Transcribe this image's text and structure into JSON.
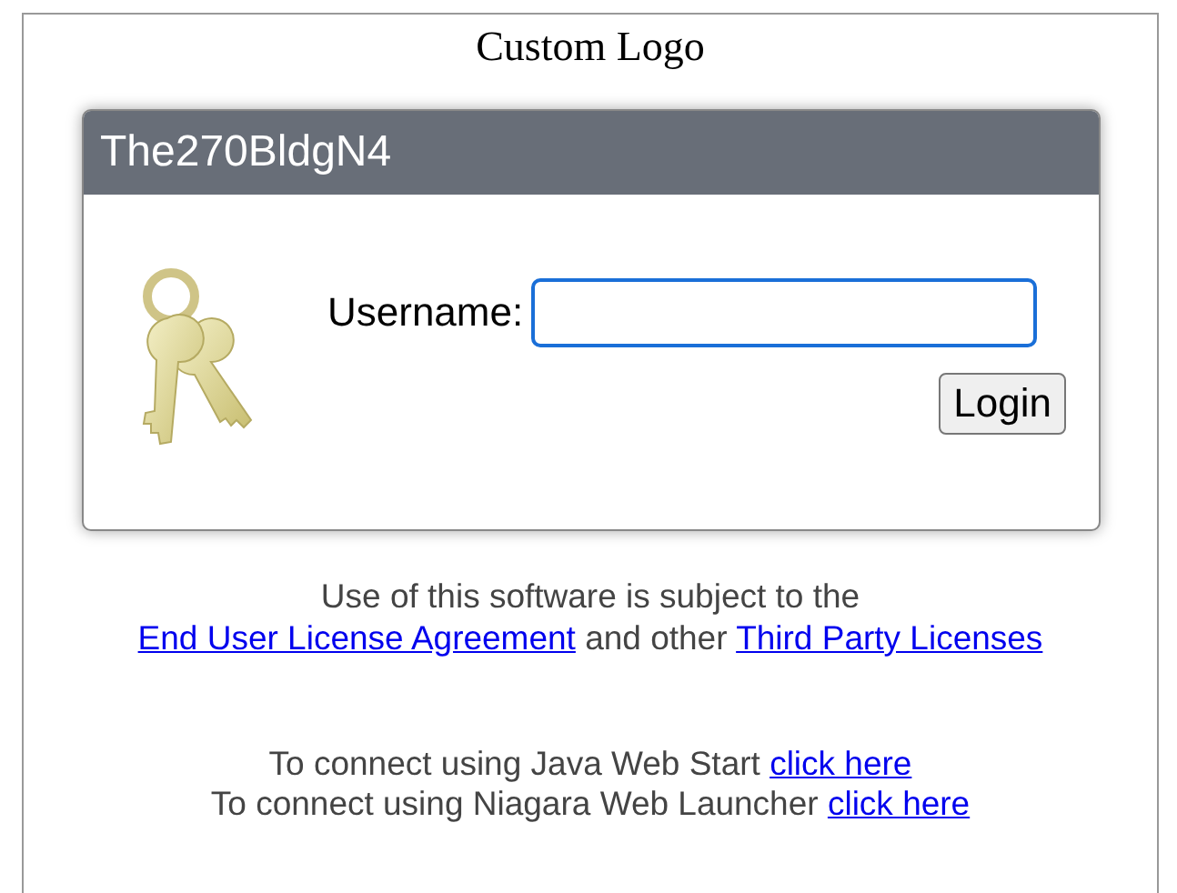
{
  "logo": "Custom Logo",
  "login": {
    "title": "The270BldgN4",
    "username_label": "Username:",
    "button": "Login"
  },
  "legal": {
    "before": "Use of this software is subject to the",
    "link1": "End User License Agreement",
    "middle": "and other",
    "link2": "Third Party Licenses"
  },
  "connect": [
    {
      "text": "To connect using Java Web Start",
      "link": "click here"
    },
    {
      "text": "To connect using Niagara Web Launcher",
      "link": "click here"
    }
  ]
}
